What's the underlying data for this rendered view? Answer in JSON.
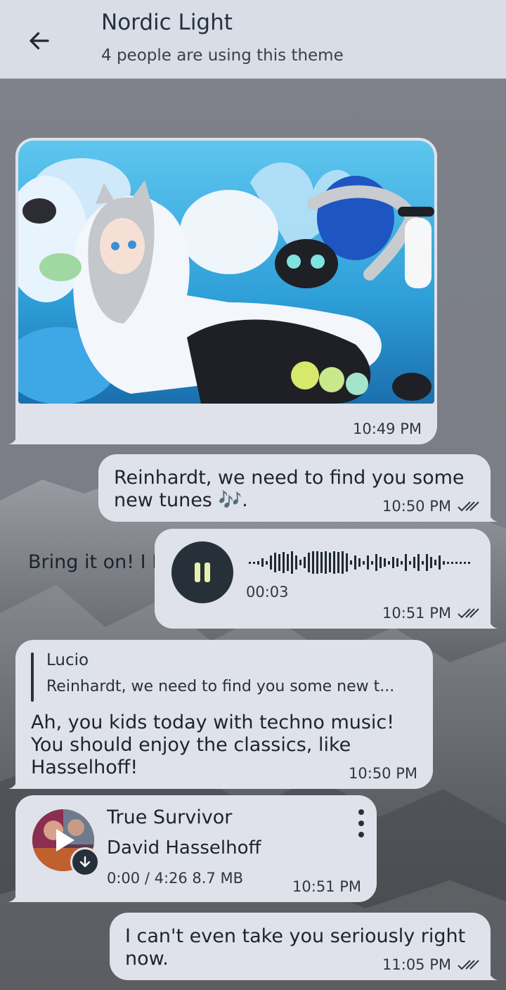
{
  "header": {
    "title": "Nordic Light",
    "subtitle": "4 people are using this theme"
  },
  "messages": [
    {
      "type": "image",
      "direction": "incoming",
      "caption": "Bring it on! I LIVE for this!",
      "time": "10:49 PM"
    },
    {
      "type": "text",
      "direction": "outgoing",
      "line1": "Reinhardt, we need to find you some",
      "line2": "new tunes 🎶.",
      "time": "10:50 PM",
      "read": true
    },
    {
      "type": "voice",
      "direction": "outgoing",
      "duration": "00:03",
      "time": "10:51 PM",
      "read": true
    },
    {
      "type": "reply",
      "direction": "incoming",
      "reply_to_name": "Lucio",
      "reply_to_text": "Reinhardt, we need to find you some new t...",
      "line1": "Ah, you kids today with techno music!",
      "line2": "You should enjoy the classics, like",
      "line3": "Hasselhoff!",
      "time": "10:50 PM"
    },
    {
      "type": "audio_file",
      "direction": "incoming",
      "title": "True Survivor",
      "artist": "David Hasselhoff",
      "meta": "0:00 / 4:26 8.7 MB",
      "time": "10:51 PM"
    },
    {
      "type": "text",
      "direction": "outgoing",
      "line1": "I can't even take you seriously right",
      "line2": "now.",
      "time": "11:05 PM",
      "read": true
    }
  ],
  "colors": {
    "header_bg": "#d9dde5",
    "bubble_bg": "#dfe2ea",
    "accent_dark": "#273038",
    "play_icon": "#e8f0b0"
  },
  "icons": {
    "back": "arrow-left-icon",
    "pause": "pause-icon",
    "play": "play-icon",
    "download": "arrow-down-icon",
    "menu": "more-vertical-icon",
    "read": "double-check-icon"
  }
}
